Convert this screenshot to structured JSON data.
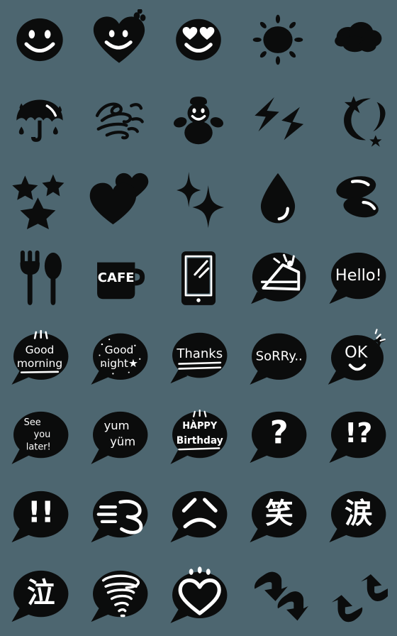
{
  "sheet": {
    "title": "Hand-drawn Black Emoji Sticker Sheet",
    "background_color": "#4d6670",
    "ink_color": "#0b0c0c",
    "highlight_color": "#ffffff",
    "columns": 5,
    "rows": 8,
    "total_stickers": 40
  },
  "stickers": [
    {
      "id": 1,
      "row": 1,
      "col": 1,
      "name": "smiley-face",
      "kind": "icon",
      "label": ""
    },
    {
      "id": 2,
      "row": 1,
      "col": 2,
      "name": "smiling-heart-face",
      "kind": "icon",
      "label": ""
    },
    {
      "id": 3,
      "row": 1,
      "col": 3,
      "name": "heart-eyes-face",
      "kind": "icon",
      "label": ""
    },
    {
      "id": 4,
      "row": 1,
      "col": 4,
      "name": "sun",
      "kind": "icon",
      "label": ""
    },
    {
      "id": 5,
      "row": 1,
      "col": 5,
      "name": "cloud",
      "kind": "icon",
      "label": ""
    },
    {
      "id": 6,
      "row": 2,
      "col": 1,
      "name": "umbrella-rain",
      "kind": "icon",
      "label": ""
    },
    {
      "id": 7,
      "row": 2,
      "col": 2,
      "name": "wind-scribble",
      "kind": "icon",
      "label": ""
    },
    {
      "id": 8,
      "row": 2,
      "col": 3,
      "name": "snowman",
      "kind": "icon",
      "label": ""
    },
    {
      "id": 9,
      "row": 2,
      "col": 4,
      "name": "lightning-bolts",
      "kind": "icon",
      "label": ""
    },
    {
      "id": 10,
      "row": 2,
      "col": 5,
      "name": "crescent-moon-stars",
      "kind": "icon",
      "label": ""
    },
    {
      "id": 11,
      "row": 3,
      "col": 1,
      "name": "three-stars",
      "kind": "icon",
      "label": ""
    },
    {
      "id": 12,
      "row": 3,
      "col": 2,
      "name": "two-hearts",
      "kind": "icon",
      "label": ""
    },
    {
      "id": 13,
      "row": 3,
      "col": 3,
      "name": "sparkles",
      "kind": "icon",
      "label": ""
    },
    {
      "id": 14,
      "row": 3,
      "col": 4,
      "name": "water-droplet",
      "kind": "icon",
      "label": ""
    },
    {
      "id": 15,
      "row": 3,
      "col": 5,
      "name": "coffee-beans",
      "kind": "icon",
      "label": ""
    },
    {
      "id": 16,
      "row": 4,
      "col": 1,
      "name": "fork-and-spoon",
      "kind": "icon",
      "label": ""
    },
    {
      "id": 17,
      "row": 4,
      "col": 2,
      "name": "cafe-mug",
      "kind": "text",
      "label": "CAFE"
    },
    {
      "id": 18,
      "row": 4,
      "col": 3,
      "name": "tablet-device",
      "kind": "icon",
      "label": ""
    },
    {
      "id": 19,
      "row": 4,
      "col": 4,
      "name": "cake-slice-bubble",
      "kind": "icon",
      "label": ""
    },
    {
      "id": 20,
      "row": 4,
      "col": 5,
      "name": "bubble-hello",
      "kind": "bubble",
      "label": "Hello!"
    },
    {
      "id": 21,
      "row": 5,
      "col": 1,
      "name": "bubble-good-morning",
      "kind": "bubble",
      "label": "Good morning",
      "line1": "Good",
      "line2": "morning"
    },
    {
      "id": 22,
      "row": 5,
      "col": 2,
      "name": "bubble-good-night",
      "kind": "bubble",
      "label": "Good night★",
      "line1": "Good",
      "line2": "night★"
    },
    {
      "id": 23,
      "row": 5,
      "col": 3,
      "name": "bubble-thanks",
      "kind": "bubble",
      "label": "Thanks"
    },
    {
      "id": 24,
      "row": 5,
      "col": 4,
      "name": "bubble-sorry",
      "kind": "bubble",
      "label": "SoRRy.."
    },
    {
      "id": 25,
      "row": 5,
      "col": 5,
      "name": "bubble-ok-smile",
      "kind": "bubble",
      "label": "OK"
    },
    {
      "id": 26,
      "row": 6,
      "col": 1,
      "name": "bubble-see-you-later",
      "kind": "bubble",
      "label": "See you later!",
      "line1": "See",
      "line2": "you",
      "line3": "later!"
    },
    {
      "id": 27,
      "row": 6,
      "col": 2,
      "name": "bubble-yum-yum",
      "kind": "bubble",
      "label": "yum yum",
      "line1": "yum",
      "line2": "yüm"
    },
    {
      "id": 28,
      "row": 6,
      "col": 3,
      "name": "bubble-happy-birthday",
      "kind": "bubble",
      "label": "HAPPY Birthday",
      "line1": "HÀPPY",
      "line2": "Birthday"
    },
    {
      "id": 29,
      "row": 6,
      "col": 4,
      "name": "bubble-question-mark",
      "kind": "bubble",
      "label": "?"
    },
    {
      "id": 30,
      "row": 6,
      "col": 5,
      "name": "bubble-interrobang",
      "kind": "bubble",
      "label": "!?"
    },
    {
      "id": 31,
      "row": 7,
      "col": 1,
      "name": "bubble-double-exclamation",
      "kind": "bubble",
      "label": "!!"
    },
    {
      "id": 32,
      "row": 7,
      "col": 2,
      "name": "bubble-sigh-puff",
      "kind": "icon",
      "label": ""
    },
    {
      "id": 33,
      "row": 7,
      "col": 3,
      "name": "bubble-angry-face",
      "kind": "icon",
      "label": ""
    },
    {
      "id": 34,
      "row": 7,
      "col": 4,
      "name": "bubble-kanji-warau",
      "kind": "bubble",
      "label": "笑"
    },
    {
      "id": 35,
      "row": 7,
      "col": 5,
      "name": "bubble-kanji-namida",
      "kind": "bubble",
      "label": "涙"
    },
    {
      "id": 36,
      "row": 8,
      "col": 1,
      "name": "bubble-kanji-naku",
      "kind": "bubble",
      "label": "泣"
    },
    {
      "id": 37,
      "row": 8,
      "col": 2,
      "name": "bubble-tornado",
      "kind": "icon",
      "label": ""
    },
    {
      "id": 38,
      "row": 8,
      "col": 3,
      "name": "bubble-sparkle-heart",
      "kind": "icon",
      "label": ""
    },
    {
      "id": 39,
      "row": 8,
      "col": 4,
      "name": "double-up-arrow",
      "kind": "icon",
      "label": ""
    },
    {
      "id": 40,
      "row": 8,
      "col": 5,
      "name": "double-down-arrow",
      "kind": "icon",
      "label": ""
    }
  ]
}
